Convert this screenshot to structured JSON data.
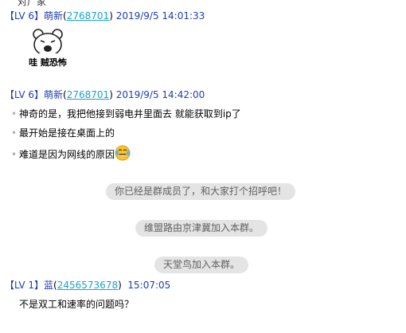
{
  "top_partial_text": "对广家",
  "messages": [
    {
      "level": "【LV 6】",
      "nick": "萌新",
      "uid": "2768701",
      "time": "2019/9/5 14:01:33",
      "sticker_caption": "哇 贼恐怖"
    },
    {
      "level": "【LV 6】",
      "nick": "萌新",
      "uid": "2768701",
      "time": "2019/9/5 14:42:00",
      "lines": [
        "神奇的是，我把他接到弱电井里面去 就能获取到ip了",
        "最开始是接在桌面上的",
        "难道是因为网线的原因"
      ],
      "emoji_icon": "laughing-tears-emoji"
    },
    {
      "level": "【LV 1】",
      "nick": "蓝",
      "uid": "2456573678",
      "time": "15:07:05",
      "lines": [
        "不是双工和速率的问题吗？"
      ]
    }
  ],
  "system_notices": [
    "你已经是群成员了，和大家打个招呼吧！",
    "维盟路由京津冀加入本群。",
    "天堂鸟加入本群。"
  ],
  "colors": {
    "name_blue": "#1f3fae",
    "uid_link": "#1aa3c8",
    "notice_bg": "#e4e4e4"
  }
}
